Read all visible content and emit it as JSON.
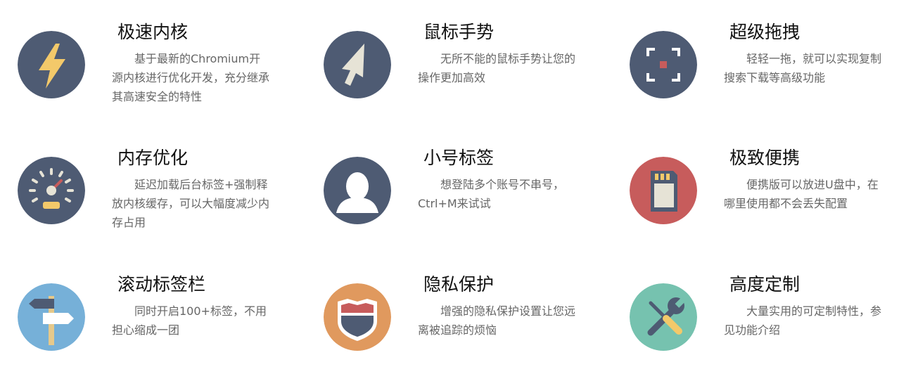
{
  "features": [
    {
      "title": "极速内核",
      "desc": "基于最新的Chromium开源内核进行优化开发，充分继承其高速安全的特性",
      "icon": "lightning-icon",
      "color": "#4e5b73"
    },
    {
      "title": "鼠标手势",
      "desc": "无所不能的鼠标手势让您的操作更加高效",
      "icon": "cursor-arrow-icon",
      "color": "#4e5b73"
    },
    {
      "title": "超级拖拽",
      "desc": "轻轻一拖，就可以实现复制搜索下载等高级功能",
      "icon": "focus-frame-icon",
      "color": "#4e5b73"
    },
    {
      "title": "内存优化",
      "desc": "延迟加载后台标签+强制释放内核缓存，可以大幅度减少内存占用",
      "icon": "speedometer-icon",
      "color": "#4e5b73"
    },
    {
      "title": "小号标签",
      "desc": "想登陆多个账号不串号，Ctrl+M来试试",
      "icon": "user-silhouette-icon",
      "color": "#4e5b73"
    },
    {
      "title": "极致便携",
      "desc": "便携版可以放进U盘中，在哪里使用都不会丢失配置",
      "icon": "sd-card-icon",
      "color": "#c75c5c"
    },
    {
      "title": "滚动标签栏",
      "desc": "同时开启100+标签，不用担心缩成一团",
      "icon": "signpost-icon",
      "color": "#76b0d8"
    },
    {
      "title": "隐私保护",
      "desc": "增强的隐私保护设置让您远离被追踪的烦恼",
      "icon": "shield-badge-icon",
      "color": "#e0995e"
    },
    {
      "title": "高度定制",
      "desc": "大量实用的可定制特性，参见功能介绍",
      "icon": "tools-icon",
      "color": "#76c2af"
    }
  ]
}
